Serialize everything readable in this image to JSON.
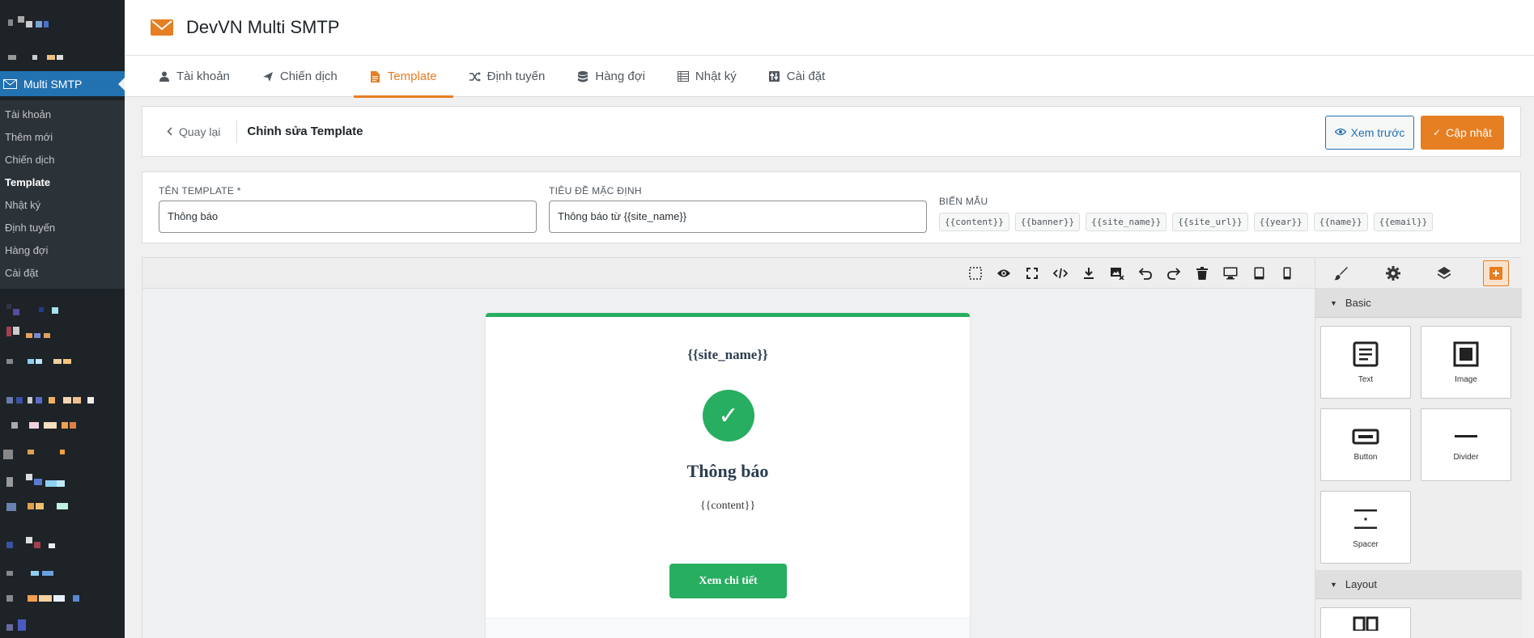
{
  "header": {
    "title": "DevVN Multi SMTP"
  },
  "sidebar": {
    "active_menu": "Multi SMTP",
    "items": [
      {
        "label": "Tài khoản"
      },
      {
        "label": "Thêm mới"
      },
      {
        "label": "Chiến dịch"
      },
      {
        "label": "Template"
      },
      {
        "label": "Nhật ký"
      },
      {
        "label": "Định tuyến"
      },
      {
        "label": "Hàng đợi"
      },
      {
        "label": "Cài đặt"
      }
    ]
  },
  "tabs": [
    {
      "label": "Tài khoản",
      "icon": "user-icon"
    },
    {
      "label": "Chiến dịch",
      "icon": "paper-plane-icon"
    },
    {
      "label": "Template",
      "icon": "file-icon"
    },
    {
      "label": "Định tuyến",
      "icon": "shuffle-icon"
    },
    {
      "label": "Hàng đợi",
      "icon": "database-icon"
    },
    {
      "label": "Nhật ký",
      "icon": "list-icon"
    },
    {
      "label": "Cài đặt",
      "icon": "settings-icon"
    }
  ],
  "actionbar": {
    "back_label": "Quay lại",
    "title": "Chỉnh sửa Template",
    "preview_label": "Xem trước",
    "update_label": "Cập nhật"
  },
  "form": {
    "name_label": "TÊN TEMPLATE *",
    "name_value": "Thông báo",
    "subject_label": "TIÊU ĐỀ MẶC ĐỊNH",
    "subject_value": "Thông báo từ {{site_name}}",
    "vars_label": "BIẾN MẪU",
    "vars": [
      "{{content}}",
      "{{banner}}",
      "{{site_name}}",
      "{{site_url}}",
      "{{year}}",
      "{{name}}",
      "{{email}}"
    ]
  },
  "email": {
    "site_name": "{{site_name}}",
    "check": "✓",
    "heading": "Thông báo",
    "content": "{{content}}",
    "button": "Xem chi tiết",
    "accent": "#27ae60"
  },
  "panel": {
    "categories": [
      "Basic",
      "Layout"
    ],
    "blocks": [
      {
        "label": "Text"
      },
      {
        "label": "Image"
      },
      {
        "label": "Button"
      },
      {
        "label": "Divider"
      },
      {
        "label": "Spacer"
      }
    ]
  },
  "colors": {
    "accent": "#e67e22",
    "wp_blue": "#2271b1",
    "sidebar": "#1d2327"
  }
}
